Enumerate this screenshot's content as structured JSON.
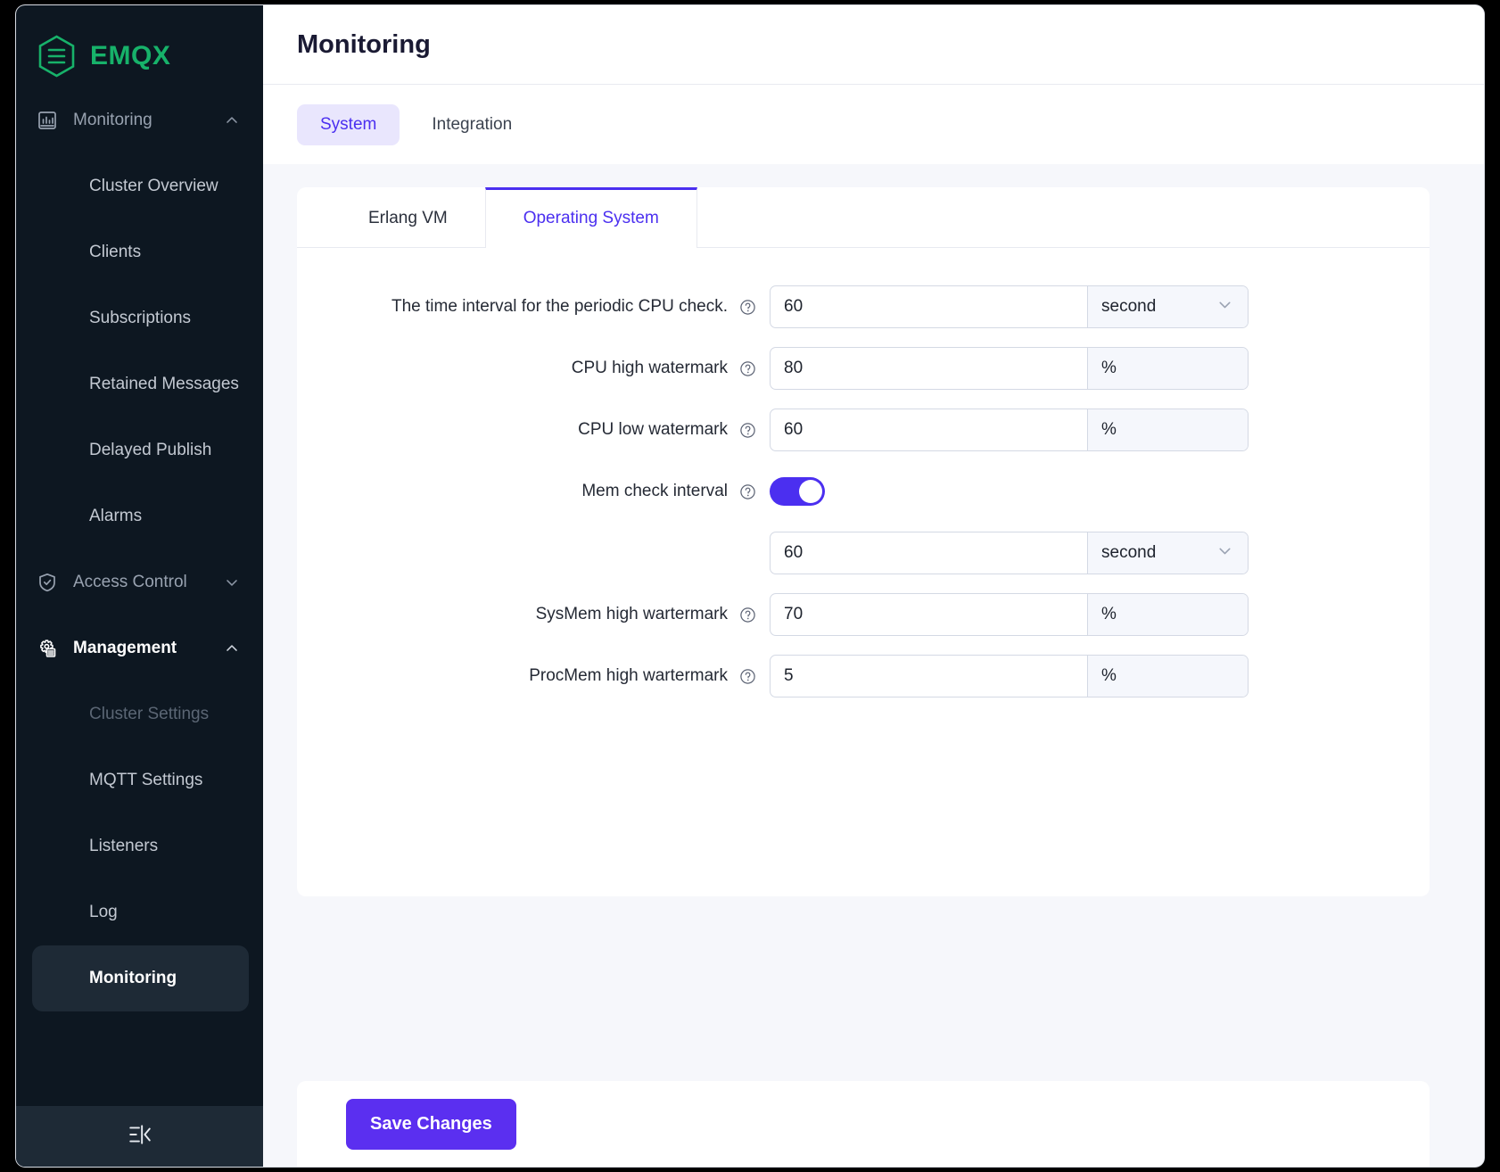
{
  "brand": {
    "name": "EMQX",
    "logo_icon": "emqx-hexagon-logo",
    "color": "#17b26a"
  },
  "sidebar": {
    "collapse_icon": "collapse-sidebar-icon",
    "groups": [
      {
        "label": "Monitoring",
        "icon": "chart-bar-icon",
        "chevron": "chevron-up-icon",
        "expanded": true
      },
      {
        "label": "Access Control",
        "icon": "shield-check-icon",
        "chevron": "chevron-down-icon",
        "expanded": false
      },
      {
        "label": "Management",
        "icon": "gear-document-icon",
        "chevron": "chevron-up-icon",
        "expanded": true
      }
    ],
    "monitoring_items": [
      "Cluster Overview",
      "Clients",
      "Subscriptions",
      "Retained Messages",
      "Delayed Publish",
      "Alarms"
    ],
    "management_items": [
      "Cluster Settings",
      "MQTT Settings",
      "Listeners",
      "Log",
      "Monitoring"
    ],
    "selected_item": "Monitoring"
  },
  "header": {
    "title": "Monitoring"
  },
  "page_tabs": [
    {
      "label": "System",
      "active": true
    },
    {
      "label": "Integration",
      "active": false
    }
  ],
  "inner_tabs": [
    {
      "label": "Erlang VM",
      "active": false
    },
    {
      "label": "Operating System",
      "active": true
    }
  ],
  "form": {
    "help_icon": "question-circle-icon",
    "chevron_icon": "chevron-down-icon",
    "rows": [
      {
        "label": "The time interval for the periodic CPU check.",
        "value": "60",
        "unit": "second",
        "unit_type": "select"
      },
      {
        "label": "CPU high watermark",
        "value": "80",
        "unit": "%",
        "unit_type": "static"
      },
      {
        "label": "CPU low watermark",
        "value": "60",
        "unit": "%",
        "unit_type": "static"
      },
      {
        "label": "Mem check interval",
        "toggle": true,
        "toggle_on": true,
        "value": "60",
        "unit": "second",
        "unit_type": "select"
      },
      {
        "label": "SysMem high wartermark",
        "value": "70",
        "unit": "%",
        "unit_type": "static"
      },
      {
        "label": "ProcMem high wartermark",
        "value": "5",
        "unit": "%",
        "unit_type": "static"
      }
    ]
  },
  "footer": {
    "save_label": "Save Changes",
    "accent": "#5b2ff0"
  }
}
